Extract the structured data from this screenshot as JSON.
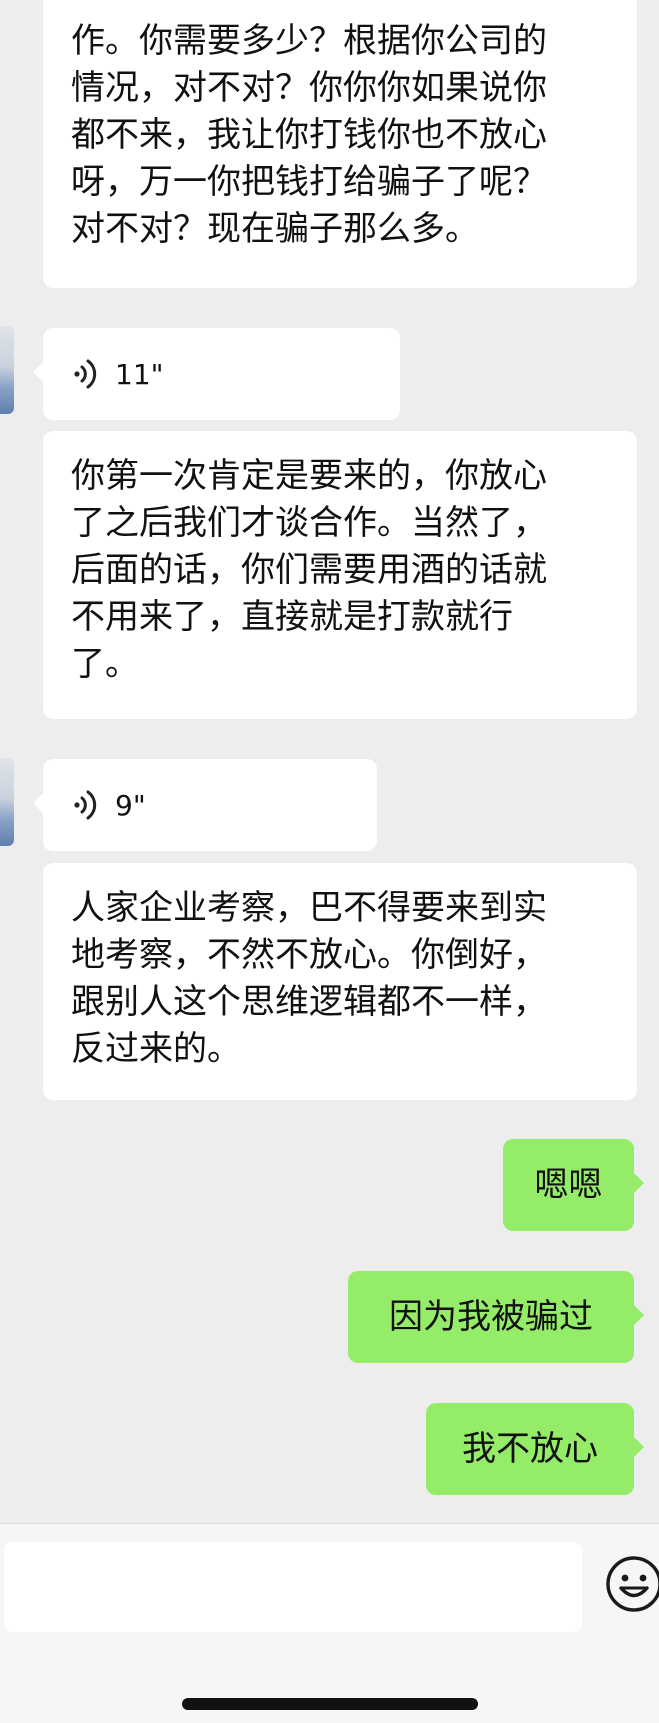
{
  "messages": [
    {
      "type": "text",
      "direction": "incoming",
      "lines": [
        "作。你需要多少？根据你公司的",
        "情况，对不对？你你你如果说你",
        "都不来，我让你打钱你也不放心",
        "呀，万一你把钱打给骗子了呢？",
        "对不对？现在骗子那么多。"
      ]
    },
    {
      "type": "voice",
      "direction": "incoming",
      "duration": "11\""
    },
    {
      "type": "text",
      "direction": "incoming",
      "lines": [
        "你第一次肯定是要来的，你放心",
        "了之后我们才谈合作。当然了，",
        "后面的话，你们需要用酒的话就",
        "不用来了，直接就是打款就行",
        "了。"
      ]
    },
    {
      "type": "voice",
      "direction": "incoming",
      "duration": "9\""
    },
    {
      "type": "text",
      "direction": "incoming",
      "lines": [
        "人家企业考察，巴不得要来到实",
        "地考察，不然不放心。你倒好，",
        "跟别人这个思维逻辑都不一样，",
        "反过来的。"
      ]
    },
    {
      "type": "text",
      "direction": "outgoing",
      "text": "嗯嗯"
    },
    {
      "type": "text",
      "direction": "outgoing",
      "text": "因为我被骗过"
    },
    {
      "type": "text",
      "direction": "outgoing",
      "text": "我不放心"
    }
  ],
  "composer": {
    "input_value": "",
    "emoji_icon": "smiley-face-icon"
  },
  "colors": {
    "background": "#ededed",
    "incoming_bubble": "#ffffff",
    "outgoing_bubble": "#95ec69"
  }
}
